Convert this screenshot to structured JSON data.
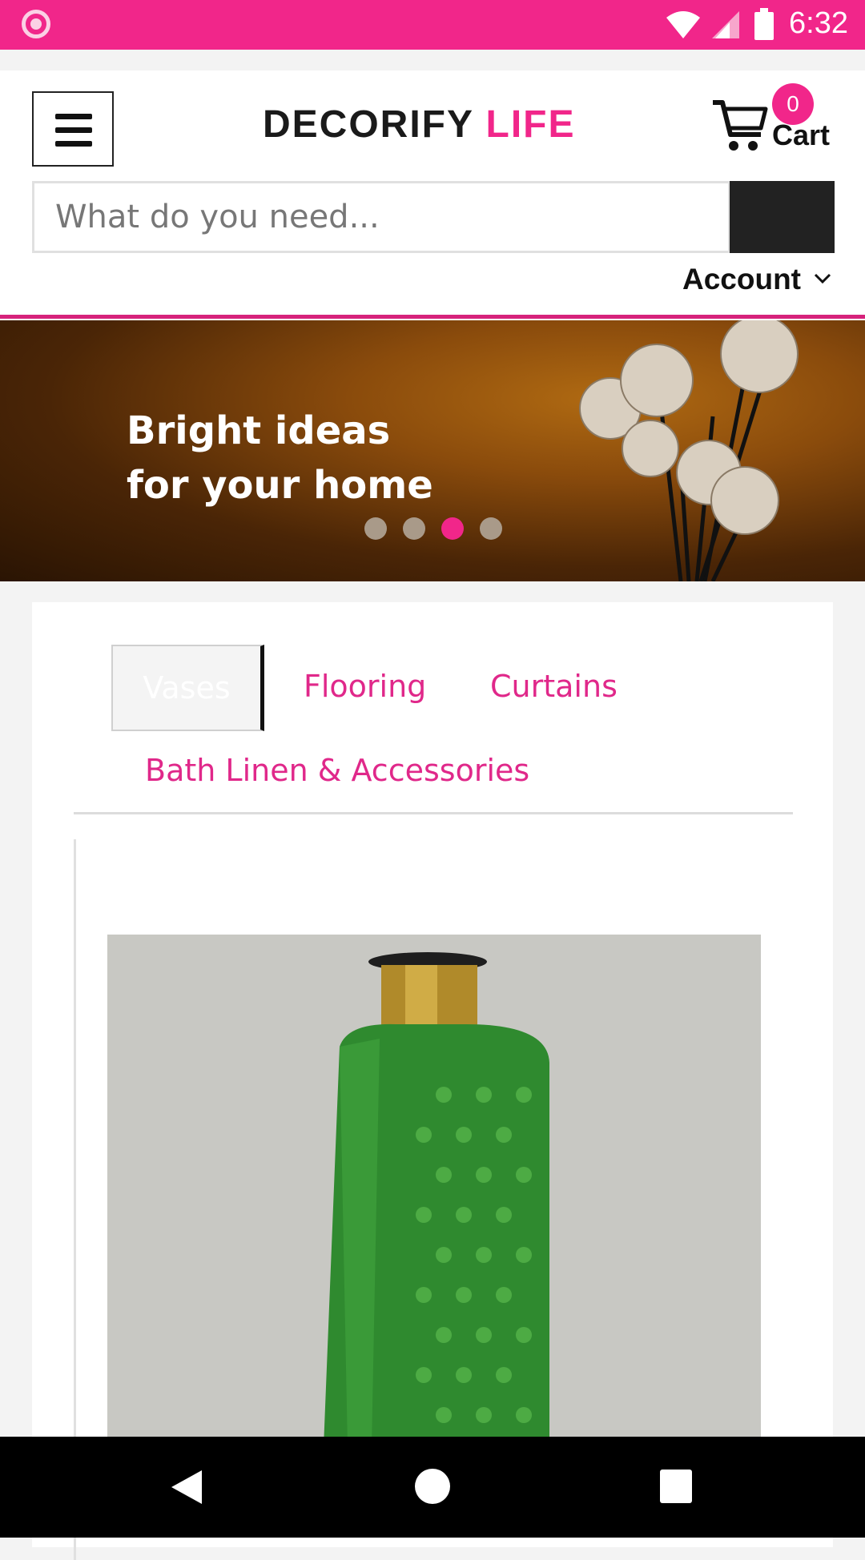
{
  "status_bar": {
    "time": "6:32"
  },
  "header": {
    "logo_part1": "DECORIFY",
    "logo_part2": "LIFE",
    "cart_count": "0",
    "cart_label": "Cart",
    "search_placeholder": "What do you need...",
    "account_label": "Account"
  },
  "banner": {
    "line1": "Bright ideas",
    "line2": "for your home",
    "slide_count": 4,
    "active_slide": 3
  },
  "tabs": {
    "items": [
      {
        "label": "Vases",
        "active": true
      },
      {
        "label": "Flooring",
        "active": false
      },
      {
        "label": "Curtains",
        "active": false
      },
      {
        "label": "Bath Linen & Accessories",
        "active": false
      }
    ]
  },
  "colors": {
    "brand_pink": "#f1268a",
    "dark": "#222222"
  },
  "icons": [
    "hamburger-menu-icon",
    "cart-icon",
    "chevron-down-icon",
    "wifi-icon",
    "signal-icon",
    "battery-icon",
    "back-icon",
    "home-icon",
    "recent-apps-icon"
  ]
}
